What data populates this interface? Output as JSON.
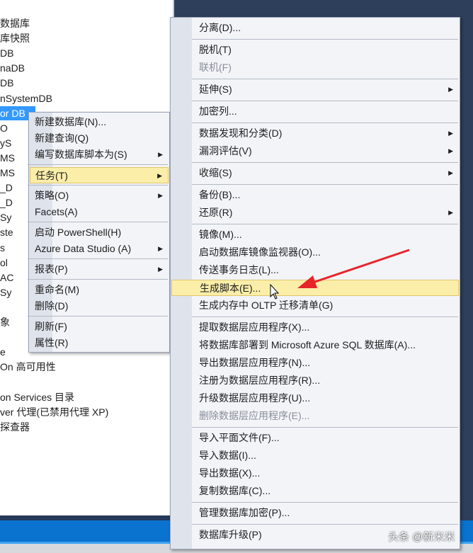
{
  "tree": [
    "数据库",
    "库快照",
    "DB",
    "naDB",
    "DB",
    "nSystemDB",
    "or  DB",
    "O",
    "yS",
    "MS",
    "MS",
    "_D",
    "_D",
    "Sy",
    "ste",
    "s",
    "ol",
    "AC",
    "Sy",
    "",
    "象",
    "",
    "e",
    "On 高可用性",
    "",
    "on Services 目录",
    "ver 代理(已禁用代理 XP)",
    "探查器"
  ],
  "context_menu": [
    {
      "label": "新建数据库(N)..."
    },
    {
      "label": "新建查询(Q)"
    },
    {
      "label": "编写数据库脚本为(S)",
      "submenu": true
    },
    {
      "sep": true
    },
    {
      "label": "任务(T)",
      "submenu": true,
      "highlighted": true
    },
    {
      "sep": true
    },
    {
      "label": "策略(O)",
      "submenu": true
    },
    {
      "label": "Facets(A)"
    },
    {
      "sep": true
    },
    {
      "label": "启动 PowerShell(H)"
    },
    {
      "label": "Azure Data Studio (A)",
      "submenu": true
    },
    {
      "sep": true
    },
    {
      "label": "报表(P)",
      "submenu": true
    },
    {
      "sep": true
    },
    {
      "label": "重命名(M)"
    },
    {
      "label": "删除(D)"
    },
    {
      "sep": true
    },
    {
      "label": "刷新(F)"
    },
    {
      "label": "属性(R)"
    }
  ],
  "tasks_menu": [
    {
      "label": "分离(D)..."
    },
    {
      "sep": true
    },
    {
      "label": "脱机(T)"
    },
    {
      "label": "联机(F)",
      "disabled": true
    },
    {
      "sep": true
    },
    {
      "label": "延伸(S)",
      "submenu": true
    },
    {
      "sep": true
    },
    {
      "label": "加密列..."
    },
    {
      "sep": true
    },
    {
      "label": "数据发现和分类(D)",
      "submenu": true
    },
    {
      "label": "漏洞评估(V)",
      "submenu": true
    },
    {
      "sep": true
    },
    {
      "label": "收缩(S)",
      "submenu": true
    },
    {
      "sep": true
    },
    {
      "label": "备份(B)..."
    },
    {
      "label": "还原(R)",
      "submenu": true
    },
    {
      "sep": true
    },
    {
      "label": "镜像(M)..."
    },
    {
      "label": "启动数据库镜像监视器(O)..."
    },
    {
      "label": "传送事务日志(L)..."
    },
    {
      "label": "生成脚本(E)...",
      "highlighted": true
    },
    {
      "label": "生成内存中 OLTP 迁移清单(G)"
    },
    {
      "sep": true
    },
    {
      "label": "提取数据层应用程序(X)..."
    },
    {
      "label": "将数据库部署到 Microsoft Azure SQL 数据库(A)..."
    },
    {
      "label": "导出数据层应用程序(N)..."
    },
    {
      "label": "注册为数据层应用程序(R)..."
    },
    {
      "label": "升级数据层应用程序(U)..."
    },
    {
      "label": "删除数据层应用程序(E)...",
      "disabled": true
    },
    {
      "sep": true
    },
    {
      "label": "导入平面文件(F)..."
    },
    {
      "label": "导入数据(I)..."
    },
    {
      "label": "导出数据(X)..."
    },
    {
      "label": "复制数据库(C)..."
    },
    {
      "sep": true
    },
    {
      "label": "管理数据库加密(P)..."
    },
    {
      "sep": true
    },
    {
      "label": "数据库升级(P)"
    }
  ],
  "watermark": "头条 @新米米",
  "colors": {
    "highlight": "#fbeea9",
    "selection": "#3399ff",
    "arrow": "#e8242b"
  }
}
